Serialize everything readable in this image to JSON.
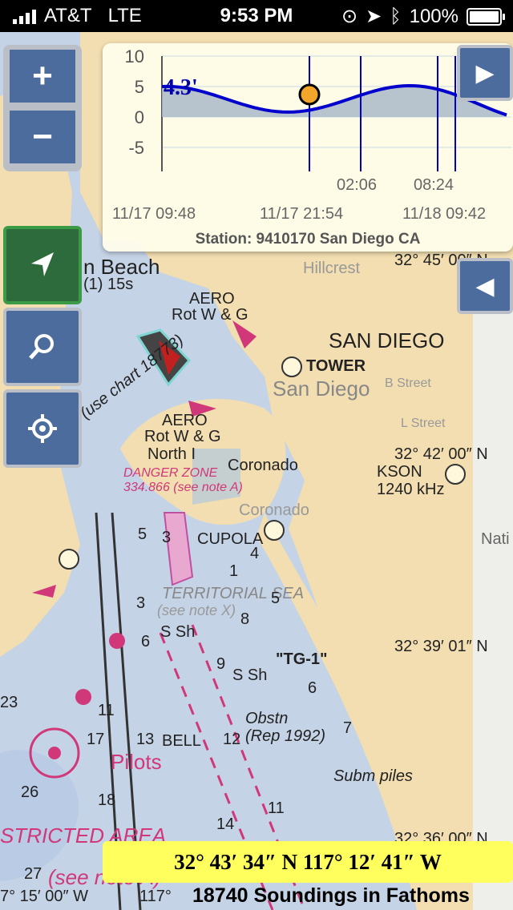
{
  "status": {
    "carrier": "AT&T",
    "network": "LTE",
    "time": "9:53 PM",
    "battery": "100%",
    "battery_level": 1.0
  },
  "controls": {
    "zoom_in": "+",
    "zoom_out": "−",
    "next_label": "▶",
    "prev_label": "◀"
  },
  "tide": {
    "current_value": "4.3'",
    "y_ticks": [
      "10",
      "5",
      "0",
      "-5"
    ],
    "time_marks": [
      "02:06",
      "08:24"
    ],
    "date_labels": [
      "11/17 09:48",
      "11/17 21:54",
      "11/18 09:42"
    ],
    "station": "Station: 9410170 San Diego CA"
  },
  "map": {
    "labels": {
      "san_diego": "SAN DIEGO",
      "tower": "TOWER",
      "san_diego_city": "San Diego",
      "coronado": "Coronado",
      "coronado2": "Coronado",
      "north_i": "North I",
      "aero1": "AERO",
      "rot1": "Rot W & G",
      "aero2": "AERO",
      "rot2": "Rot W & G",
      "cupola": "CUPOLA",
      "kson": "KSON",
      "kson_freq": "1240 kHz",
      "danger": "DANGER ZONE",
      "danger_freq": "334.866 (see note A)",
      "territorial": "TERRITORIAL SEA",
      "see_note_x": "(see note X)",
      "pilots": "Pilots",
      "tg1": "\"TG-1\"",
      "obstn": "Obstn",
      "rep": "(Rep 1992)",
      "subm_piles": "Subm piles",
      "bell": "BELL",
      "restricted": "STRICTED AREA",
      "see_note_a": "(see note A)",
      "beach": "n Beach",
      "beach_light": "(1) 15s",
      "use_chart": "(use chart 18773)",
      "lat_45": "32° 45′ 00″ N",
      "lat_42": "32° 42′ 00″ N",
      "lat_39": "32° 39′ 01″ N",
      "lat_36": "32° 36′ 00″ N",
      "lon_15": "7° 15′ 00″ W",
      "lon_117": "117°",
      "sh1": "S Sh",
      "sh2": "S Sh",
      "hillcrest": "Hillcrest",
      "l_street": "L Street",
      "b_street": "B Street",
      "nati": "Nati"
    },
    "soundings": [
      "6",
      "8",
      "9",
      "11",
      "13",
      "17",
      "23",
      "12",
      "18",
      "7",
      "14",
      "27",
      "26",
      "11",
      "6",
      "5",
      "3",
      "4",
      "5",
      "1",
      "3"
    ]
  },
  "position": {
    "coords": "32° 43′ 34″ N 117° 12′ 41″ W"
  },
  "footer": {
    "title": "18740 Soundings in Fathoms"
  },
  "colors": {
    "land": "#f2deb0",
    "water": "#c5d3e6",
    "shallow": "#a9c4e4",
    "button": "#4d6c9e",
    "locate_active": "#2d6b3d",
    "tide_line": "#0000cc",
    "tide_marker": "#f4a62a",
    "coord_bar": "#ffff5e",
    "danger": "#d0387a"
  }
}
